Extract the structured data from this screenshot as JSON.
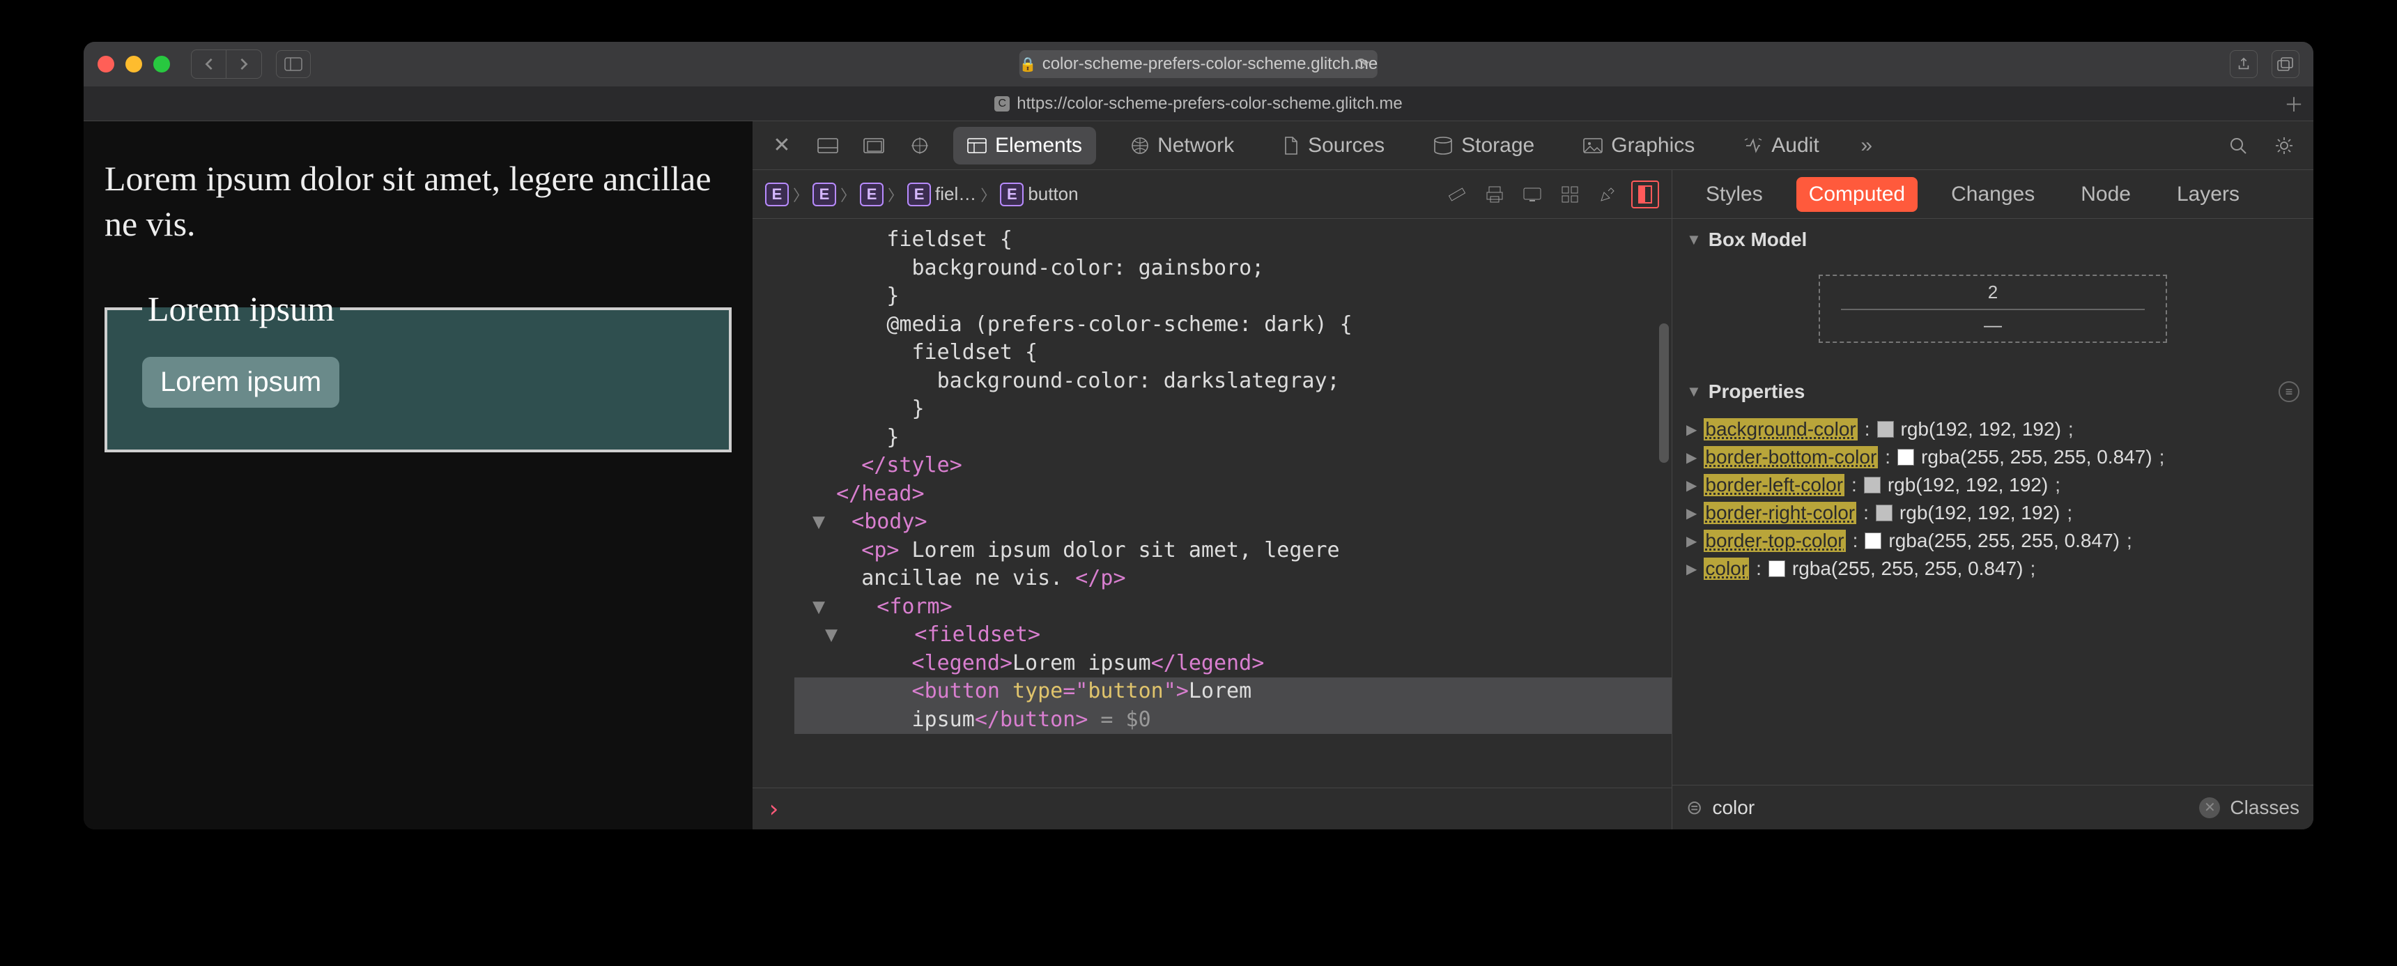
{
  "titlebar": {
    "url_display": "color-scheme-prefers-color-scheme.glitch.me",
    "tab_url": "https://color-scheme-prefers-color-scheme.glitch.me"
  },
  "page": {
    "paragraph": "Lorem ipsum dolor sit amet, legere ancillae ne vis.",
    "legend": "Lorem ipsum",
    "button": "Lorem ipsum"
  },
  "devtools": {
    "tabs": {
      "elements": "Elements",
      "network": "Network",
      "sources": "Sources",
      "storage": "Storage",
      "graphics": "Graphics",
      "audit": "Audit"
    },
    "breadcrumb": {
      "fiel": "fiel…",
      "button": "button"
    },
    "code": {
      "l1": "      fieldset {",
      "l2": "        background-color: gainsboro;",
      "l3": "      }",
      "l4": "      @media (prefers-color-scheme: dark) {",
      "l5": "        fieldset {",
      "l6": "          background-color: darkslategray;",
      "l7": "        }",
      "l8": "      }",
      "l9_a": "    </",
      "l9_b": "style",
      "l9_c": ">",
      "l10_a": "  </",
      "l10_b": "head",
      "l10_c": ">",
      "l11_a": "  <",
      "l11_b": "body",
      "l11_c": ">",
      "l12_a": "    <",
      "l12_b": "p",
      "l12_c": ">",
      "l12_d": " Lorem ipsum dolor sit amet, legere",
      "l13": "    ancillae ne vis. ",
      "l13_a": "</",
      "l13_b": "p",
      "l13_c": ">",
      "l14_a": "    <",
      "l14_b": "form",
      "l14_c": ">",
      "l15_a": "      <",
      "l15_b": "fieldset",
      "l15_c": ">",
      "l16_a": "        <",
      "l16_b": "legend",
      "l16_c": ">",
      "l16_d": "Lorem ipsum",
      "l16_e": "</",
      "l16_f": "legend",
      "l16_g": ">",
      "l17_a": "        <",
      "l17_b": "button ",
      "l17_c": "type",
      "l17_d": "=\"",
      "l17_e": "button",
      "l17_f": "\">",
      "l17_g": "Lorem",
      "l18_a": "        ipsum",
      "l18_b": "</",
      "l18_c": "button",
      "l18_d": ">",
      "l18_e": " = $0"
    },
    "side_tabs": {
      "styles": "Styles",
      "computed": "Computed",
      "changes": "Changes",
      "node": "Node",
      "layers": "Layers"
    },
    "box_model": {
      "title": "Box Model",
      "top": "2",
      "mid": "—"
    },
    "properties": {
      "title": "Properties",
      "rows": {
        "bg": {
          "name": "background-color",
          "value": "rgb(192, 192, 192)"
        },
        "bb": {
          "name": "border-bottom-color",
          "value": "rgba(255, 255, 255, 0.847)"
        },
        "bl": {
          "name": "border-left-color",
          "value": "rgb(192, 192, 192)"
        },
        "br": {
          "name": "border-right-color",
          "value": "rgb(192, 192, 192)"
        },
        "bt": {
          "name": "border-top-color",
          "value": "rgba(255, 255, 255, 0.847)"
        },
        "c": {
          "name": "color",
          "value": "rgba(255, 255, 255, 0.847)"
        }
      }
    },
    "filter": {
      "value": "color",
      "classes": "Classes"
    }
  }
}
